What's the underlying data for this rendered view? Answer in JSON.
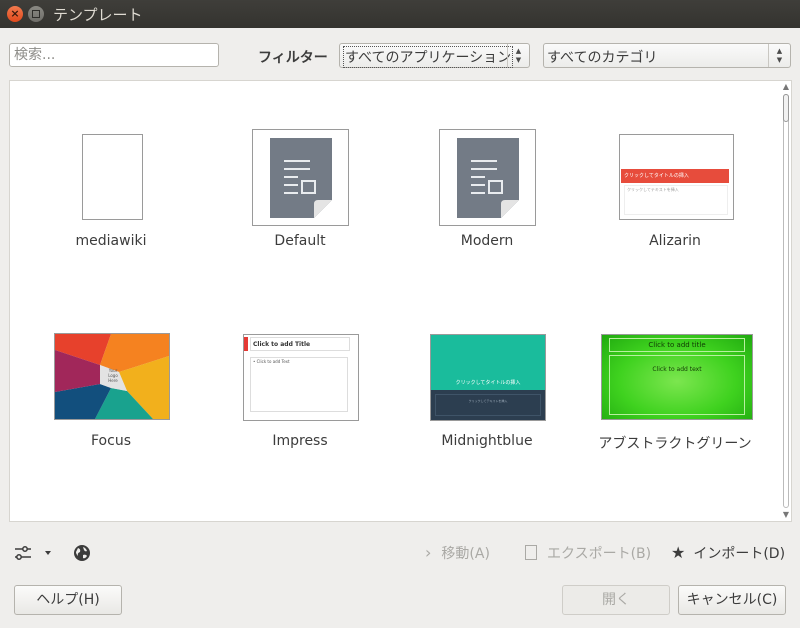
{
  "window": {
    "title": "テンプレート"
  },
  "toolbar": {
    "search_placeholder": "検索...",
    "filter_label": "フィルター",
    "app_filter_value": "すべてのアプリケーション",
    "category_filter_value": "すべてのカテゴリ"
  },
  "templates": [
    {
      "name": "mediawiki"
    },
    {
      "name": "Default"
    },
    {
      "name": "Modern"
    },
    {
      "name": "Alizarin",
      "thumb_title": "クリックしてタイトルの挿入",
      "thumb_text": "クリックしてテキストを挿入",
      "accent": "#e74c3c"
    },
    {
      "name": "Focus",
      "thumb_text_lines": [
        "Your",
        "Logo",
        "Here"
      ]
    },
    {
      "name": "Impress",
      "thumb_title": "Click to add Title",
      "thumb_text": "• Click to add Text",
      "accent": "#e53935"
    },
    {
      "name": "Midnightblue",
      "thumb_title": "クリックしてタイトルの挿入",
      "thumb_text": "クリックしてテキストを挿入",
      "accent": "#1abc9c"
    },
    {
      "name": "アブストラクトグリーン",
      "thumb_title": "Click to add title",
      "thumb_text": "Click to add text",
      "accent": "#3fd21f"
    }
  ],
  "actions": {
    "move_label": "移動(A)",
    "export_label": "エクスポート(B)",
    "import_label": "インポート(D)"
  },
  "buttons": {
    "help_label": "ヘルプ(H)",
    "open_label": "開く",
    "cancel_label": "キャンセル(C)"
  }
}
